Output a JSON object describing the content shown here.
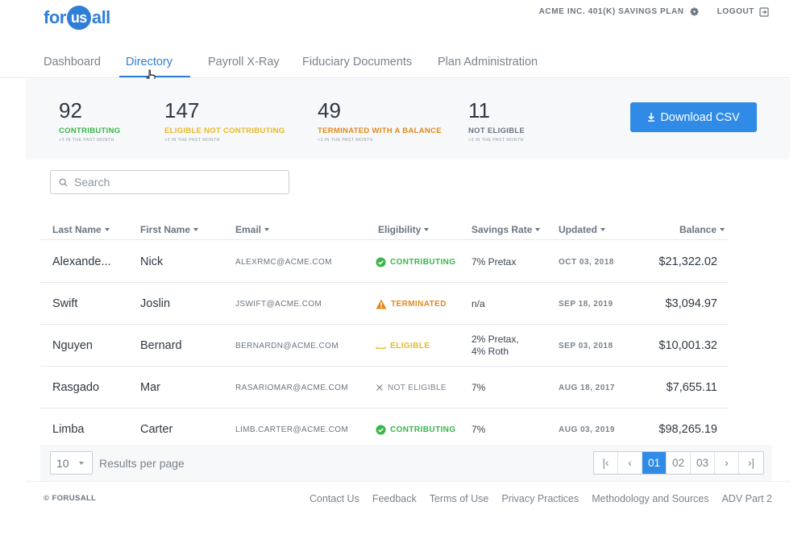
{
  "header": {
    "logo": {
      "pre": "for",
      "mid": "us",
      "post": "all"
    },
    "plan_name": "ACME INC. 401(K) SAVINGS PLAN",
    "logout": "LOGOUT"
  },
  "tabs": [
    {
      "label": "Dashboard"
    },
    {
      "label": "Directory",
      "active": true
    },
    {
      "label": "Payroll X-Ray"
    },
    {
      "label": "Fiduciary Documents"
    },
    {
      "label": "Plan Administration"
    }
  ],
  "stats": [
    {
      "value": "92",
      "label": "CONTRIBUTING",
      "sub": "+3 IN THE PAST MONTH",
      "color": "#3bb54a"
    },
    {
      "value": "147",
      "label": "ELIGIBLE NOT CONTRIBUTING",
      "sub": "+3 IN THE PAST MONTH",
      "color": "#e5b92a"
    },
    {
      "value": "49",
      "label": "TERMINATED WITH A BALANCE",
      "sub": "+3 IN THE PAST MONTH",
      "color": "#e08a1e"
    },
    {
      "value": "11",
      "label": "NOT ELIGIBLE",
      "sub": "+3 IN THE PAST MONTH",
      "color": "#6b7582"
    }
  ],
  "download_label": "Download CSV",
  "search": {
    "placeholder": "Search"
  },
  "columns": [
    "Last Name",
    "First Name",
    "Email",
    "Eligibility",
    "Savings Rate",
    "Updated",
    "Balance"
  ],
  "rows": [
    {
      "last": "Alexande...",
      "first": "Nick",
      "email": "ALEXRMC@ACME.COM",
      "eligibility": "CONTRIBUTING",
      "elig_icon": "check-circle-icon",
      "elig_color": "#3bb54a",
      "rate1": "7% Pretax",
      "rate2": "",
      "updated": "OCT 03, 2018",
      "balance": "$21,322.02"
    },
    {
      "last": "Swift",
      "first": "Joslin",
      "email": "JSWIFT@ACME.COM",
      "eligibility": "TERMINATED",
      "elig_icon": "warning-icon",
      "elig_color": "#e08a1e",
      "rate1": "n/a",
      "rate2": "",
      "updated": "SEP 18, 2019",
      "balance": "$3,094.97"
    },
    {
      "last": "Nguyen",
      "first": "Bernard",
      "email": "BERNARDN@ACME.COM",
      "eligibility": "ELIGIBLE",
      "elig_icon": "dash-icon",
      "elig_color": "#e5b92a",
      "rate1": "2% Pretax,",
      "rate2": "4% Roth",
      "updated": "SEP 03, 2018",
      "balance": "$10,001.32"
    },
    {
      "last": "Rasgado",
      "first": "Mar",
      "email": "RASARIOMAR@ACME.COM",
      "eligibility": "NOT ELIGIBLE",
      "elig_icon": "x-icon",
      "elig_color": "#7a838d",
      "rate1": "7%",
      "rate2": "",
      "updated": "AUG 18, 2017",
      "balance": "$7,655.11"
    },
    {
      "last": "Limba",
      "first": "Carter",
      "email": "LIMB.CARTER@ACME.COM",
      "eligibility": "CONTRIBUTING",
      "elig_icon": "check-circle-icon",
      "elig_color": "#3bb54a",
      "rate1": "7%",
      "rate2": "",
      "updated": "AUG 03, 2019",
      "balance": "$98,265.19"
    }
  ],
  "pagination": {
    "per_page": "10",
    "per_page_label": "Results per page",
    "first": "|‹",
    "prev": "‹",
    "pages": [
      "01",
      "02",
      "03"
    ],
    "current": "01",
    "next": "›",
    "last": "›|"
  },
  "footer": {
    "copyright": "© FORUSALL",
    "links": [
      "Contact Us",
      "Feedback",
      "Terms of Use",
      "Privacy Practices",
      "Methodology and Sources",
      "ADV Part 2"
    ]
  },
  "colors": {
    "accent": "#2f8be6",
    "contributing": "#3bb54a",
    "eligible": "#e5b92a",
    "terminated": "#e08a1e"
  }
}
